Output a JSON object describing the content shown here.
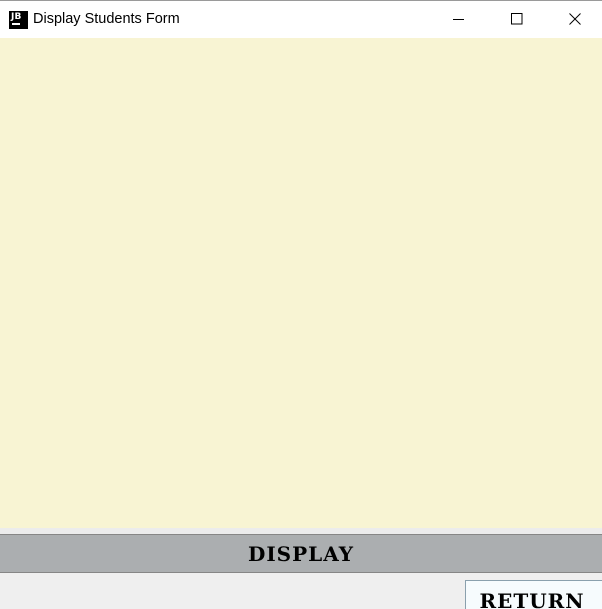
{
  "window": {
    "title": "Display Students Form",
    "app_icon_text": "JB"
  },
  "colors": {
    "content_background": "#f8f4d3",
    "display_bar": "#abaeb0",
    "return_button": "#f6fbfd",
    "window_background": "#efefef"
  },
  "title_controls": {
    "minimize_icon": "minimize-icon",
    "maximize_icon": "maximize-icon",
    "close_icon": "close-icon"
  },
  "actions": {
    "display_label": "DISPLAY",
    "return_label": "RETURN"
  }
}
